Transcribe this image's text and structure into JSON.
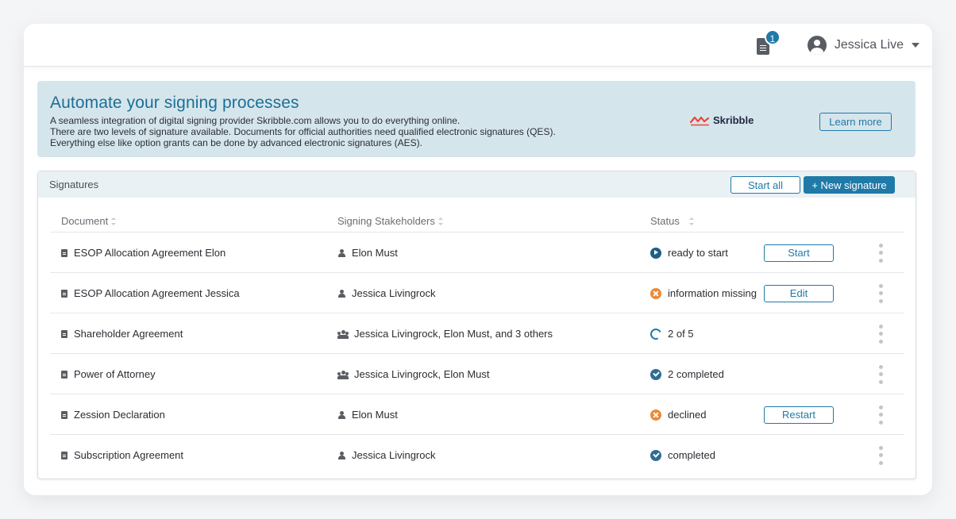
{
  "topbar": {
    "notification_count": "1",
    "user_name": "Jessica Live"
  },
  "banner": {
    "title": "Automate your signing processes",
    "line1": "A seamless integration of digital signing provider Skribble.com allows you to do everything online.",
    "line2": "There are two levels of signature available. Documents for official authorities need qualified electronic signatures (QES).",
    "line3": "Everything else like option grants can be done by advanced electronic signatures (AES).",
    "brand": "Skribble",
    "learn_more": "Learn more"
  },
  "panel": {
    "title": "Signatures",
    "start_all": "Start all",
    "new_signature": "+ New signature"
  },
  "table": {
    "headers": {
      "document": "Document",
      "stakeholders": "Signing Stakeholders",
      "status": "Status"
    },
    "rows": [
      {
        "document": "ESOP Allocation Agreement Elon",
        "stakeholders": "Elon Must",
        "stakeholder_icon": "person-icon",
        "status": "ready to start",
        "status_icon": "play-icon",
        "action": "Start"
      },
      {
        "document": "ESOP Allocation Agreement Jessica",
        "stakeholders": "Jessica Livingrock",
        "stakeholder_icon": "person-icon",
        "status": "information missing",
        "status_icon": "warning-icon",
        "action": "Edit"
      },
      {
        "document": "Shareholder Agreement",
        "stakeholders": "Jessica Livingrock, Elon Must, and 3 others",
        "stakeholder_icon": "people-icon",
        "status": "2 of 5",
        "status_icon": "progress-ring-icon",
        "action": ""
      },
      {
        "document": "Power of Attorney",
        "stakeholders": "Jessica Livingrock, Elon Must",
        "stakeholder_icon": "people-icon",
        "status": "2 completed",
        "status_icon": "check-icon",
        "action": ""
      },
      {
        "document": "Zession Declaration",
        "stakeholders": "Elon Must",
        "stakeholder_icon": "person-icon",
        "status": "declined",
        "status_icon": "warning-icon",
        "action": "Restart"
      },
      {
        "document": "Subscription Agreement",
        "stakeholders": "Jessica Livingrock",
        "stakeholder_icon": "person-icon",
        "status": "completed",
        "status_icon": "check-icon",
        "action": ""
      }
    ]
  },
  "colors": {
    "accent": "#1f7aa8",
    "banner_bg": "#d5e5ec",
    "warning": "#ec8a36",
    "skribble_red": "#e8473b"
  }
}
